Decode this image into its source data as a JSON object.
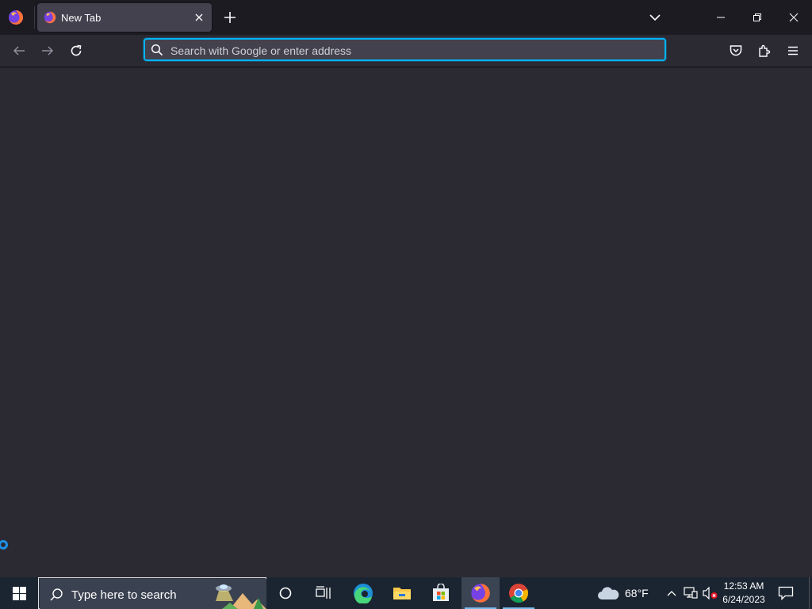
{
  "browser": {
    "tab": {
      "title": "New Tab",
      "favicon": "firefox-icon"
    },
    "urlbar": {
      "placeholder": "Search with Google or enter address",
      "value": "",
      "icon": "search-icon"
    },
    "accent_color": "#00b3f4",
    "background_color": "#2b2a33",
    "toolbar_icons": [
      "back-icon",
      "forward-icon",
      "reload-icon",
      "pocket-icon",
      "extensions-icon",
      "hamburger-menu-icon"
    ]
  },
  "taskbar": {
    "search_placeholder": "Type here to search",
    "pinned": [
      "cortana-icon",
      "task-view-icon",
      "edge-icon",
      "file-explorer-icon",
      "microsoft-store-icon",
      "firefox-icon",
      "chrome-icon"
    ],
    "weather": {
      "temperature": "68°F",
      "icon": "cloud-icon"
    },
    "clock": {
      "time": "12:53 AM",
      "date": "6/24/2023"
    }
  }
}
